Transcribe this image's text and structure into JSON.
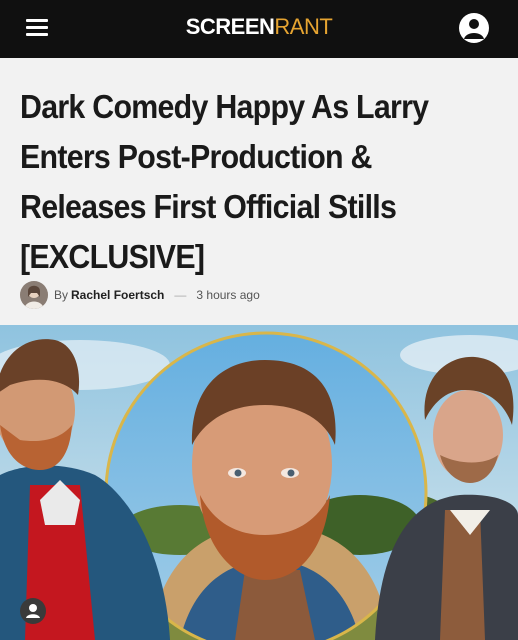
{
  "header": {
    "logo_part1": "SCREEN",
    "logo_part2": "RANT",
    "menu_icon": "hamburger-menu-icon",
    "account_icon": "user-account-icon"
  },
  "article": {
    "headline": "Dark Comedy Happy As Larry Enters Post-Production & Releases First Official Stills [EXCLUSIVE]",
    "by_prefix": "By",
    "author": "Rachel Foertsch",
    "separator": "—",
    "time": "3 hours ago"
  },
  "hero_image": {
    "description_icon": "hero-still-image"
  },
  "overlay": {
    "profile_icon": "user-profile-icon"
  },
  "colors": {
    "header_bg": "#101010",
    "brand_accent": "#e6a431",
    "ring": "#d9b64a"
  }
}
